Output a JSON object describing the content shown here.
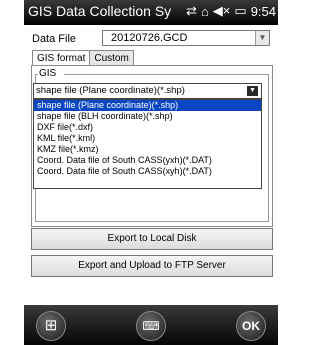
{
  "titlebar": {
    "title": "GIS Data Collection Sy",
    "icons": {
      "connectivity": "⇄",
      "signal": "⌂",
      "volume": "◀×",
      "battery": "▭"
    },
    "time": "9:54"
  },
  "datafile": {
    "label": "Data File",
    "value": "20120726.GCD"
  },
  "tabs": [
    "GIS format",
    "Custom"
  ],
  "gis_group": {
    "legend": "GIS",
    "selected_format": "shape file (Plane coordinate)(*.shp)",
    "options": [
      "shape file (Plane coordinate)(*.shp)",
      "shape file (BLH coordinate)(*.shp)",
      "DXF file(*.dxf)",
      "KML file(*.kml)",
      "KMZ file(*.kmz)",
      "Coord. Data file of South CASS(yxh)(*.DAT)",
      "Coord. Data file of South CASS(xyh)(*.DAT)"
    ]
  },
  "buttons": {
    "export": "Export to Local Disk",
    "upload": "Export and Upload to FTP Server"
  },
  "softkeys": {
    "start": "⊞",
    "keyboard": "⌨",
    "ok": "OK"
  }
}
